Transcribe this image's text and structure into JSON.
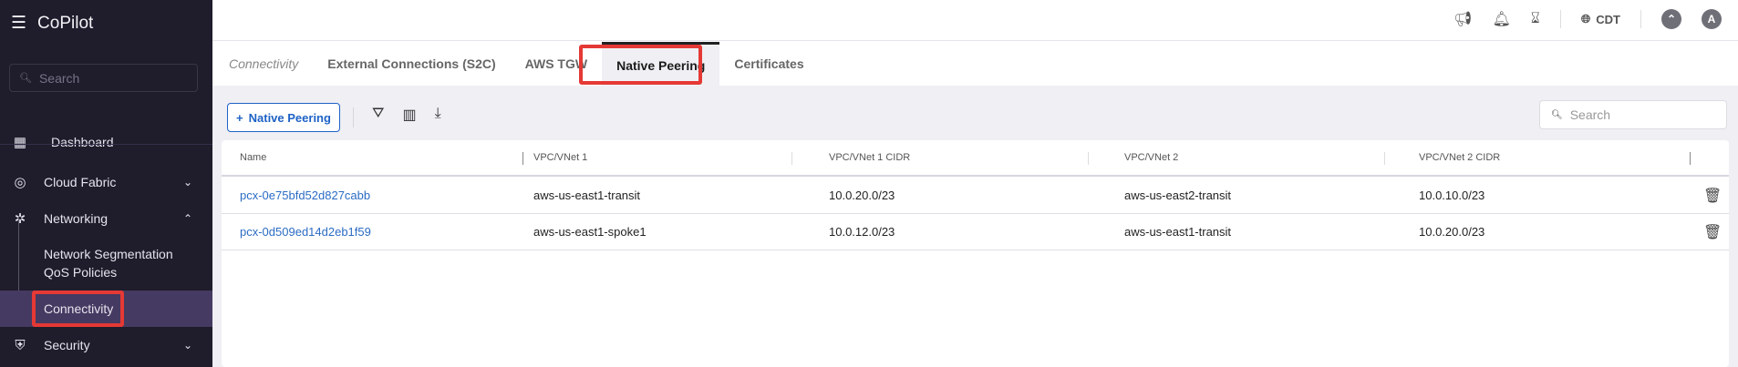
{
  "sidebar": {
    "title": "CoPilot",
    "search_placeholder": "Search",
    "items": [
      {
        "label": "Dashboard",
        "icon": "dashboard-icon"
      },
      {
        "label": "Cloud Fabric",
        "icon": "cloud-fabric-icon"
      },
      {
        "label": "Networking",
        "icon": "networking-icon"
      },
      {
        "label": "Network Segmentation"
      },
      {
        "label": "QoS Policies"
      },
      {
        "label": "Connectivity",
        "active": true
      },
      {
        "label": "Security",
        "icon": "shield-icon"
      }
    ]
  },
  "topbar": {
    "timezone": "CDT",
    "avatar": "A"
  },
  "tabs": {
    "breadcrumb": "Connectivity",
    "items": [
      "External Connections (S2C)",
      "AWS TGW",
      "Native Peering",
      "Certificates"
    ],
    "active": "Native Peering"
  },
  "toolbar": {
    "add_label": "Native Peering",
    "search_placeholder": "Search"
  },
  "table": {
    "headers": [
      "Name",
      "VPC/VNet 1",
      "VPC/VNet 1 CIDR",
      "VPC/VNet 2",
      "VPC/VNet 2 CIDR"
    ],
    "rows": [
      [
        "pcx-0e75bfd52d827cabb",
        "aws-us-east1-transit",
        "10.0.20.0/23",
        "aws-us-east2-transit",
        "10.0.10.0/23"
      ],
      [
        "pcx-0d509ed14d2eb1f59",
        "aws-us-east1-spoke1",
        "10.0.12.0/23",
        "aws-us-east1-transit",
        "10.0.20.0/23"
      ]
    ]
  },
  "colors": {
    "sidebar_bg": "#1f1c2b",
    "active_item": "#453a61",
    "accent": "#1e62c6",
    "highlight": "#e53935"
  }
}
